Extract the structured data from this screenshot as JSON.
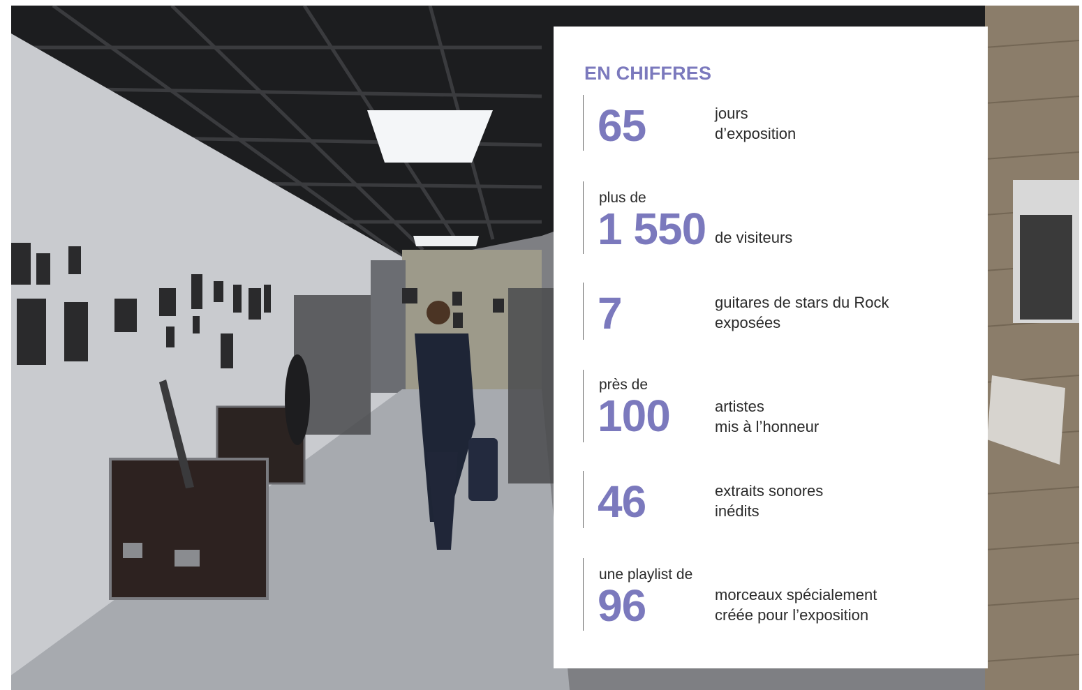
{
  "title": "EN CHIFFRES",
  "stats": [
    {
      "prefix": "",
      "value": "65",
      "desc1": "jours",
      "desc2": "d’exposition"
    },
    {
      "prefix": "plus de",
      "value": "1 550",
      "desc1": "de visiteurs",
      "desc2": ""
    },
    {
      "prefix": "",
      "value": "7",
      "desc1": "guitares de stars du Rock",
      "desc2": "exposées"
    },
    {
      "prefix": "près de",
      "value": "100",
      "desc1": "artistes",
      "desc2": "mis à l’honneur"
    },
    {
      "prefix": "",
      "value": "46",
      "desc1": "extraits sonores",
      "desc2": "inédits"
    },
    {
      "prefix": "une playlist de",
      "value": "96",
      "desc1": "morceaux spécialement",
      "desc2": "créée pour l’exposition"
    }
  ],
  "colors": {
    "accent": "#7b79bd",
    "text": "#2b2b2b"
  }
}
